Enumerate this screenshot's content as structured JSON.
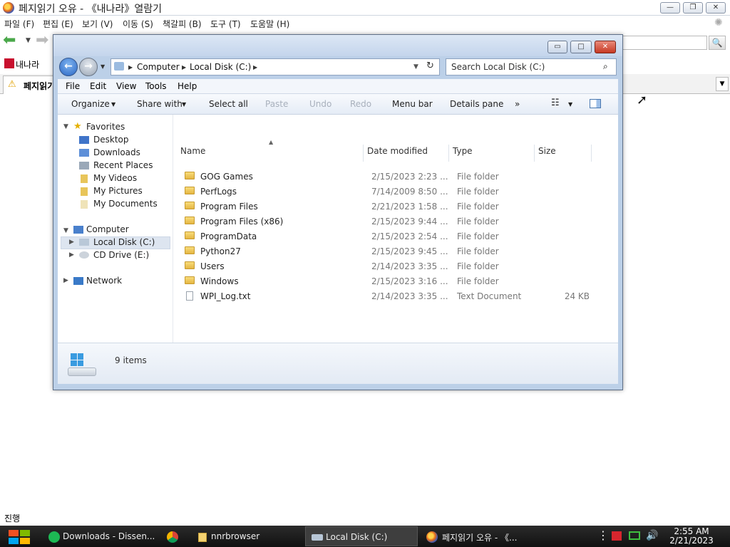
{
  "browser": {
    "title": "페지읽기 오유 - 《내나라》열람기",
    "menu": [
      "파일 (F)",
      "편집 (E)",
      "보기 (V)",
      "이동 (S)",
      "책갈피 (B)",
      "도구 (T)",
      "도움말 (H)"
    ],
    "bookmark": "내나라",
    "tab_label": "페지읽기",
    "status": "진행"
  },
  "explorer": {
    "breadcrumb": [
      "Computer",
      "Local Disk (C:)"
    ],
    "search_placeholder": "Search Local Disk (C:)",
    "menu": [
      "File",
      "Edit",
      "View",
      "Tools",
      "Help"
    ],
    "commands": {
      "organize": "Organize",
      "share_with": "Share with",
      "select_all": "Select all",
      "paste": "Paste",
      "undo": "Undo",
      "redo": "Redo",
      "menu_bar": "Menu bar",
      "details_pane": "Details pane",
      "more": "»"
    },
    "nav": {
      "favorites": "Favorites",
      "fav_items": [
        "Desktop",
        "Downloads",
        "Recent Places",
        "My Videos",
        "My Pictures",
        "My Documents"
      ],
      "computer": "Computer",
      "computer_items": [
        "Local Disk (C:)",
        "CD Drive (E:)"
      ],
      "network": "Network"
    },
    "columns": {
      "name": "Name",
      "date": "Date modified",
      "type": "Type",
      "size": "Size"
    },
    "files": [
      {
        "name": "GOG Games",
        "date": "2/15/2023 2:23 ...",
        "type": "File folder",
        "size": "",
        "kind": "folder"
      },
      {
        "name": "PerfLogs",
        "date": "7/14/2009 8:50 ...",
        "type": "File folder",
        "size": "",
        "kind": "folder"
      },
      {
        "name": "Program Files",
        "date": "2/21/2023 1:58 ...",
        "type": "File folder",
        "size": "",
        "kind": "folder"
      },
      {
        "name": "Program Files (x86)",
        "date": "2/15/2023 9:44 ...",
        "type": "File folder",
        "size": "",
        "kind": "folder"
      },
      {
        "name": "ProgramData",
        "date": "2/15/2023 2:54 ...",
        "type": "File folder",
        "size": "",
        "kind": "folder"
      },
      {
        "name": "Python27",
        "date": "2/15/2023 9:45 ...",
        "type": "File folder",
        "size": "",
        "kind": "folder"
      },
      {
        "name": "Users",
        "date": "2/14/2023 3:35 ...",
        "type": "File folder",
        "size": "",
        "kind": "folder"
      },
      {
        "name": "Windows",
        "date": "2/15/2023 3:16 ...",
        "type": "File folder",
        "size": "",
        "kind": "folder"
      },
      {
        "name": "WPI_Log.txt",
        "date": "2/14/2023 3:35 ...",
        "type": "Text Document",
        "size": "24 KB",
        "kind": "text"
      }
    ],
    "item_count": "9 items"
  },
  "taskbar": {
    "items": [
      {
        "label": "Downloads - Dissen...",
        "icon": "app-icon"
      },
      {
        "label": "",
        "icon": "chrome-icon"
      },
      {
        "label": "nnrbrowser",
        "icon": "folder-icon"
      },
      {
        "label": "Local Disk (C:)",
        "icon": "drive-icon"
      },
      {
        "label": "페지읽기 오유 - 《...",
        "icon": "browser-icon"
      }
    ],
    "time": "2:55 AM",
    "date": "2/21/2023"
  }
}
